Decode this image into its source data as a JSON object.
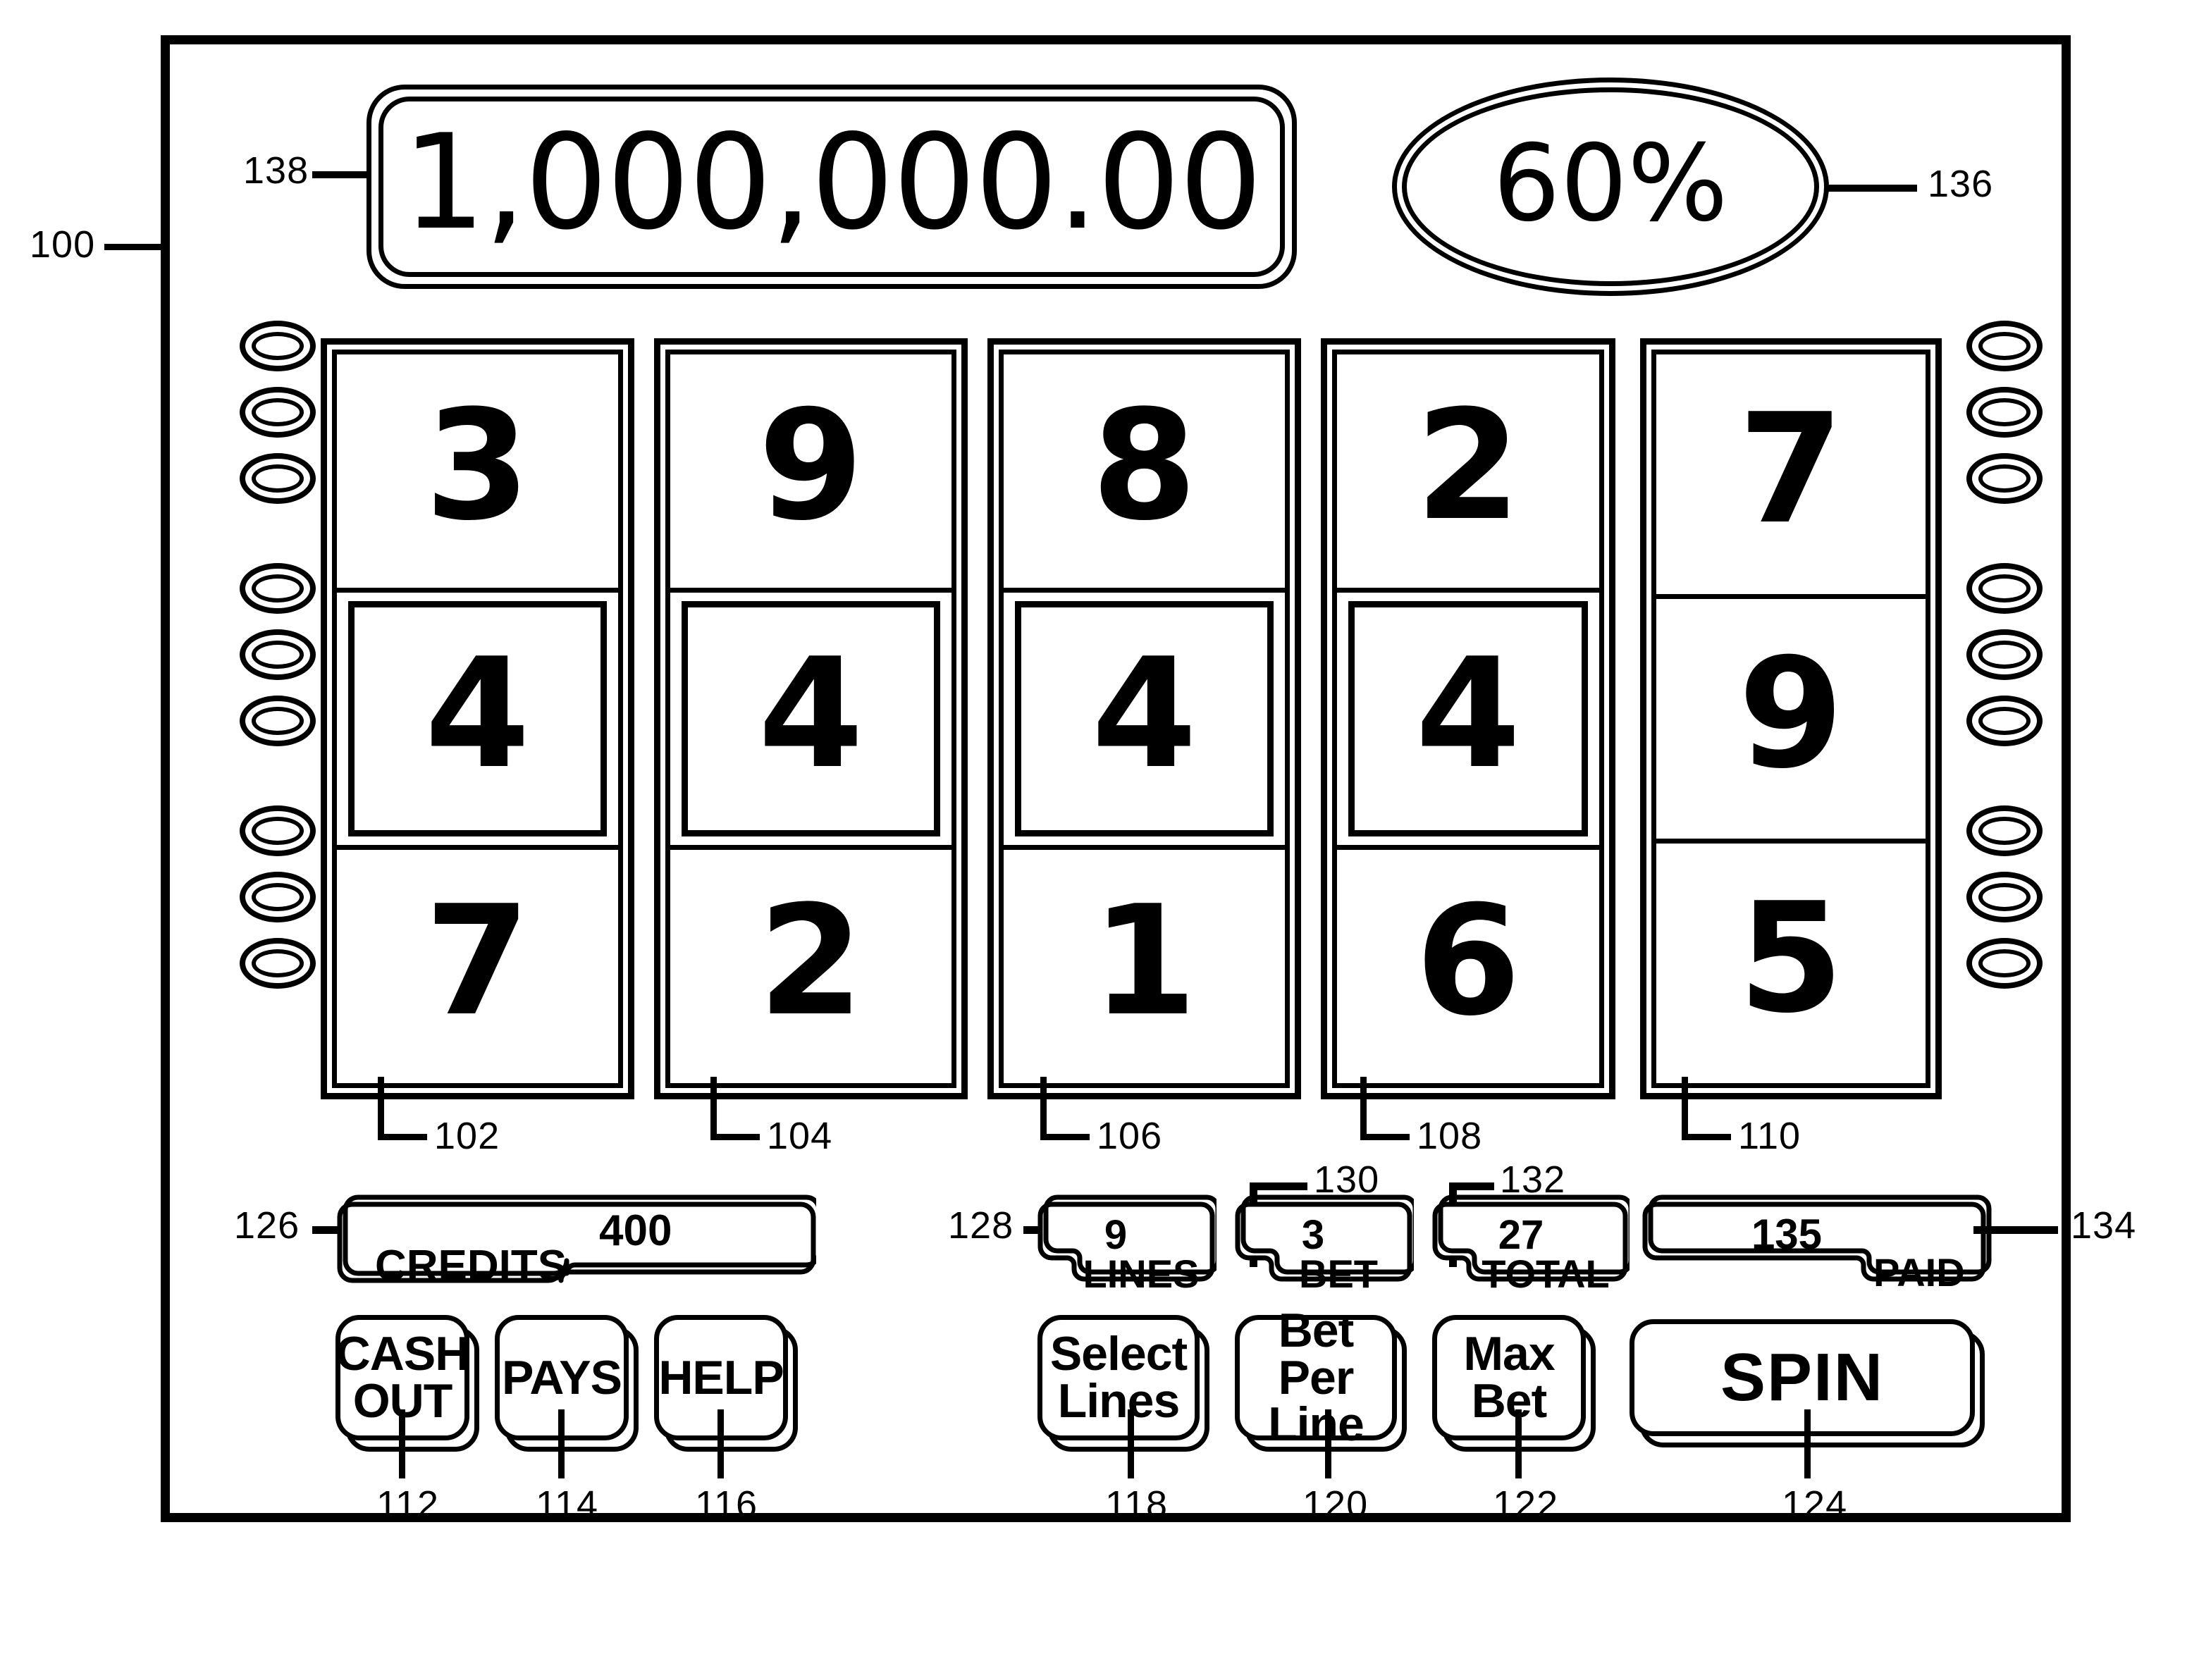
{
  "figure": {
    "type": "patent-figure",
    "subject": "slot-machine-display",
    "machine_ref": "100"
  },
  "top_displays": {
    "credit_meter": {
      "value": "1,000,000.00",
      "ref": "138"
    },
    "payback_percent": {
      "value": "60%",
      "ref": "136"
    }
  },
  "reels": [
    {
      "ref": "102",
      "symbols": [
        "3",
        "4",
        "7"
      ],
      "payline_row": 1
    },
    {
      "ref": "104",
      "symbols": [
        "9",
        "4",
        "2"
      ],
      "payline_row": 1
    },
    {
      "ref": "106",
      "symbols": [
        "8",
        "4",
        "1"
      ],
      "payline_row": 1
    },
    {
      "ref": "108",
      "symbols": [
        "2",
        "4",
        "6"
      ],
      "payline_row": 1
    },
    {
      "ref": "110",
      "symbols": [
        "7",
        "9",
        "5"
      ],
      "payline_row": -1
    }
  ],
  "meters": {
    "credits": {
      "label": "CREDITS",
      "value": "400",
      "ref": "126"
    },
    "lines": {
      "label": "LINES",
      "value": "9",
      "ref": "128"
    },
    "bet": {
      "label": "BET",
      "value": "3",
      "ref": "130"
    },
    "total": {
      "label": "TOTAL",
      "value": "27",
      "ref": "132"
    },
    "paid": {
      "label": "PAID",
      "value": "135",
      "ref": "134"
    }
  },
  "buttons": {
    "left": [
      {
        "label": "CASH\nOUT",
        "ref": "112",
        "name": "cash-out"
      },
      {
        "label": "PAYS",
        "ref": "114",
        "name": "pays"
      },
      {
        "label": "HELP",
        "ref": "116",
        "name": "help"
      }
    ],
    "right": [
      {
        "label": "Select\nLines",
        "ref": "118",
        "name": "select-lines"
      },
      {
        "label": "Bet Per\nLine",
        "ref": "120",
        "name": "bet-per-line"
      },
      {
        "label": "Max\nBet",
        "ref": "122",
        "name": "max-bet"
      },
      {
        "label": "SPIN",
        "ref": "124",
        "name": "spin"
      }
    ]
  },
  "lamps": {
    "count_per_side": 9,
    "groups_per_side": 3,
    "per_group": 3
  }
}
